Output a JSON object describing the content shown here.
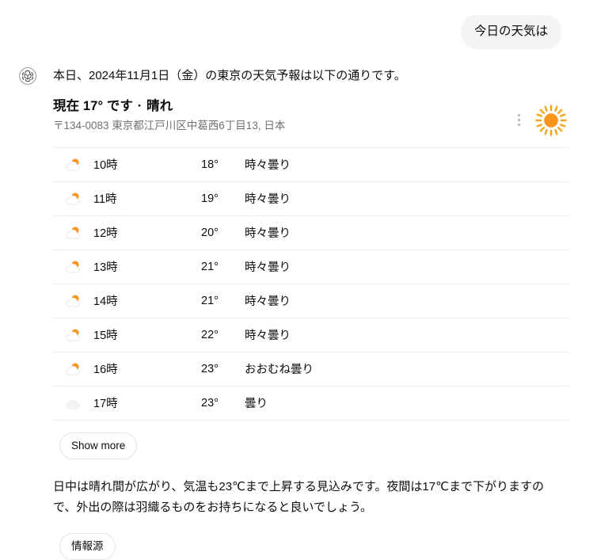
{
  "conversation": {
    "user_message": "今日の天気は",
    "assistant_avatar_icon": "openai-logo-icon",
    "intro_text": "本日、2024年11月1日（金）の東京の天気予報は以下の通りです。"
  },
  "weather": {
    "current_heading_prefix": "現在",
    "current_temperature": "17°",
    "current_suffix": "です",
    "separator": "·",
    "current_condition": "晴れ",
    "address": "〒134-0083 東京都江戸川区中葛西6丁目13, 日本",
    "main_icon": "sun-icon",
    "menu_icon": "kebab-menu-icon",
    "accent_color": "#f5a623",
    "sun_color": "#f7941d",
    "cloud_color": "#f1f1f1",
    "divider_color": "#ececec",
    "hourly": [
      {
        "icon": "partly-cloudy-icon",
        "time": "10時",
        "temp": "18°",
        "condition": "時々曇り"
      },
      {
        "icon": "partly-cloudy-icon",
        "time": "11時",
        "temp": "19°",
        "condition": "時々曇り"
      },
      {
        "icon": "partly-cloudy-icon",
        "time": "12時",
        "temp": "20°",
        "condition": "時々曇り"
      },
      {
        "icon": "partly-cloudy-icon",
        "time": "13時",
        "temp": "21°",
        "condition": "時々曇り"
      },
      {
        "icon": "partly-cloudy-icon",
        "time": "14時",
        "temp": "21°",
        "condition": "時々曇り"
      },
      {
        "icon": "partly-cloudy-icon",
        "time": "15時",
        "temp": "22°",
        "condition": "時々曇り"
      },
      {
        "icon": "partly-cloudy-icon",
        "time": "16時",
        "temp": "23°",
        "condition": "おおむね曇り"
      },
      {
        "icon": "cloudy-icon",
        "time": "17時",
        "temp": "23°",
        "condition": "曇り"
      }
    ],
    "show_more_label": "Show more"
  },
  "summary_text": "日中は晴れ間が広がり、気温も23℃まで上昇する見込みです。夜間は17℃まで下がりますので、外出の際は羽織るものをお持ちになると良いでしょう。",
  "sources_label": "情報源"
}
